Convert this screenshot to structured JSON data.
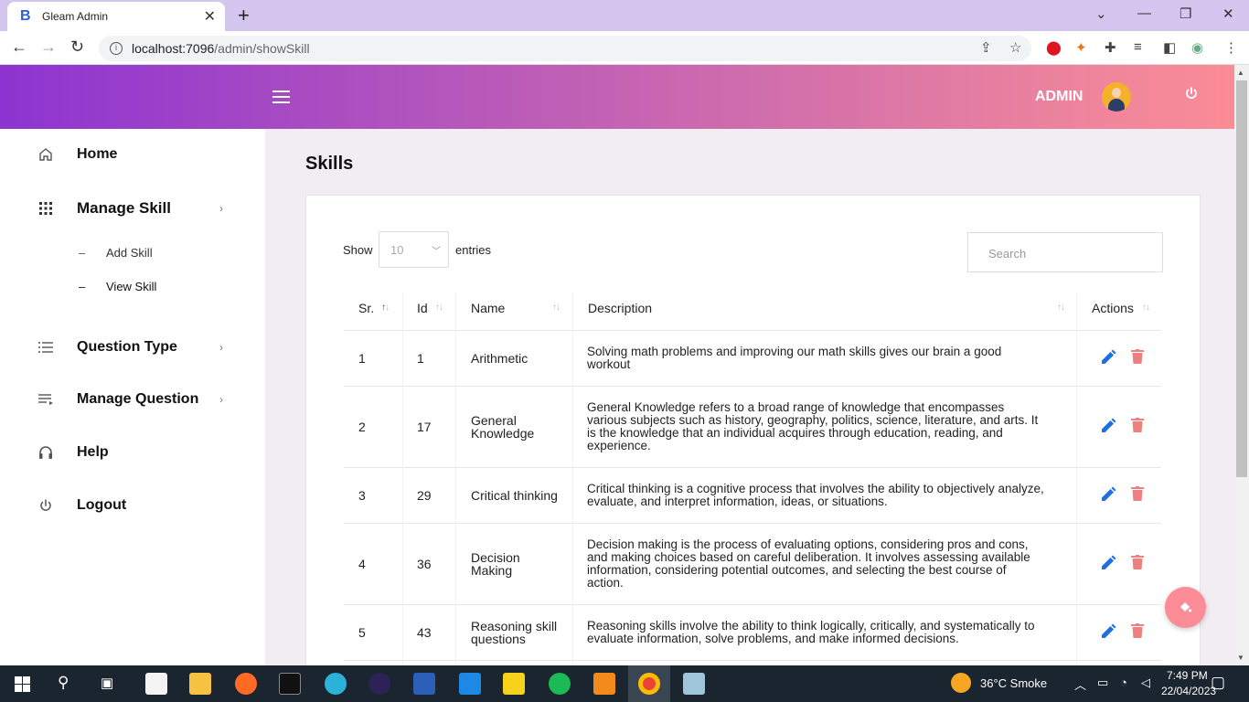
{
  "browser": {
    "tab_title": "Gleam Admin",
    "tab_favicon": "B",
    "url_host": "localhost:7096",
    "url_path": "/admin/showSkill"
  },
  "header": {
    "admin_label": "ADMIN",
    "gradient_start": "#8d34d1",
    "gradient_end": "#fb8c96"
  },
  "sidebar": {
    "items": [
      {
        "label": "Home",
        "icon": "home-icon"
      },
      {
        "label": "Manage Skill",
        "icon": "grid-icon"
      },
      {
        "label": "Question Type",
        "icon": "list-icon"
      },
      {
        "label": "Manage Question",
        "icon": "playlist-icon"
      },
      {
        "label": "Help",
        "icon": "headset-icon"
      },
      {
        "label": "Logout",
        "icon": "power-icon"
      }
    ],
    "sub_items": [
      {
        "label": "Add Skill"
      },
      {
        "label": "View Skill"
      }
    ]
  },
  "main": {
    "title": "Skills",
    "show_label": "Show",
    "entries_value": "10",
    "entries_label": "entries",
    "search_placeholder": "Search",
    "columns": [
      "Sr.",
      "Id",
      "Name",
      "Description",
      "Actions"
    ],
    "rows": [
      {
        "sr": "1",
        "id": "1",
        "name": [
          "Arithmetic"
        ],
        "description": [
          "Solving math problems and improving our math skills gives our brain a good",
          "workout"
        ]
      },
      {
        "sr": "2",
        "id": "17",
        "name": [
          "General",
          "Knowledge"
        ],
        "description": [
          "General Knowledge refers to a broad range of knowledge that encompasses",
          "various subjects such as history, geography, politics, science, literature, and arts. It",
          "is the knowledge that an individual acquires through education, reading, and",
          "experience."
        ]
      },
      {
        "sr": "3",
        "id": "29",
        "name": [
          "Critical thinking"
        ],
        "description": [
          "Critical thinking is a cognitive process that involves the ability to objectively analyze,",
          "evaluate, and interpret information, ideas, or situations."
        ]
      },
      {
        "sr": "4",
        "id": "36",
        "name": [
          "Decision",
          "Making"
        ],
        "description": [
          "Decision making is the process of evaluating options, considering pros and cons,",
          "and making choices based on careful deliberation. It involves assessing available",
          "information, considering potential outcomes, and selecting the best course of",
          "action."
        ]
      },
      {
        "sr": "5",
        "id": "43",
        "name": [
          "Reasoning skill",
          "questions"
        ],
        "description": [
          "Reasoning skills involve the ability to think logically, critically, and systematically to",
          "evaluate information, solve problems, and make informed decisions."
        ]
      }
    ]
  },
  "taskbar": {
    "weather": "36°C  Smoke",
    "time": "7:49 PM",
    "date": "22/04/2023"
  }
}
